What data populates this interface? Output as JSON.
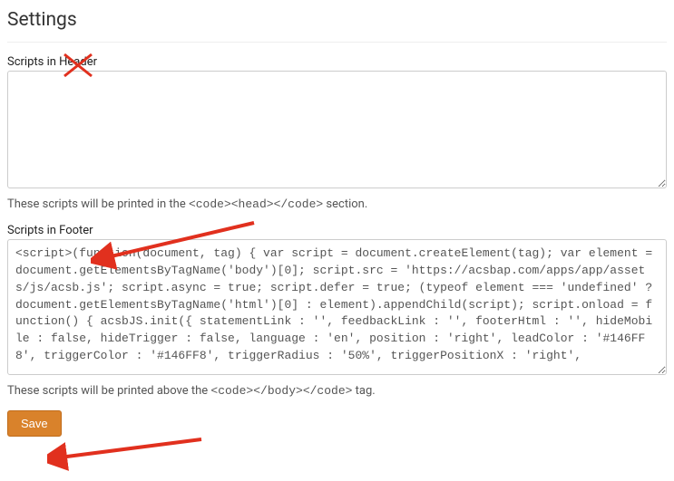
{
  "page": {
    "title": "Settings"
  },
  "header_scripts": {
    "label": "Scripts in Header",
    "value": "",
    "hint_pre": "These scripts will be printed in the ",
    "hint_code": "<code><head></code>",
    "hint_post": " section."
  },
  "footer_scripts": {
    "label": "Scripts in Footer",
    "value": "<script>(function(document, tag) { var script = document.createElement(tag); var element = document.getElementsByTagName('body')[0]; script.src = 'https://acsbap.com/apps/app/assets/js/acsb.js'; script.async = true; script.defer = true; (typeof element === 'undefined' ? document.getElementsByTagName('html')[0] : element).appendChild(script); script.onload = function() { acsbJS.init({ statementLink : '', feedbackLink : '', footerHtml : '', hideMobile : false, hideTrigger : false, language : 'en', position : 'right', leadColor : '#146FF8', triggerColor : '#146FF8', triggerRadius : '50%', triggerPositionX : 'right',",
    "hint_pre": "These scripts will be printed above the ",
    "hint_code": "<code></body></code>",
    "hint_post": " tag."
  },
  "actions": {
    "save_label": "Save"
  },
  "annotations": {
    "color": "#e1301e"
  }
}
